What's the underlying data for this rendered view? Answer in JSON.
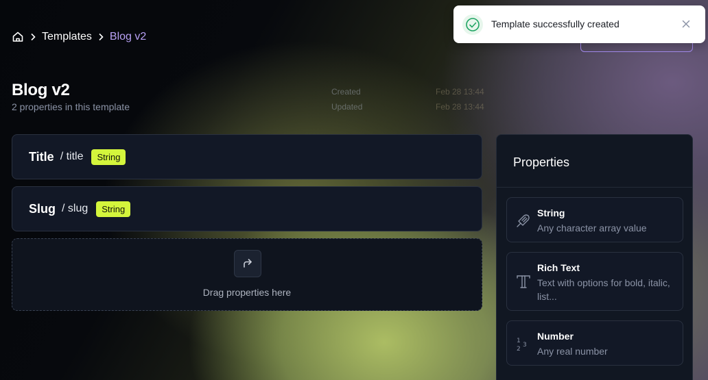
{
  "breadcrumb": {
    "home_icon": "home-icon",
    "separator_icon": "chevron-right-icon",
    "items": [
      "Templates",
      "Blog v2"
    ]
  },
  "header": {
    "title": "Blog v2",
    "subtitle": "2 properties in this template",
    "meta": [
      {
        "label": "Created",
        "value": "Feb 28 13:44"
      },
      {
        "label": "Updated",
        "value": "Feb 28 13:44"
      }
    ]
  },
  "fields": [
    {
      "name": "Title",
      "key": "/ title",
      "type": "String"
    },
    {
      "name": "Slug",
      "key": "/ slug",
      "type": "String"
    }
  ],
  "dropzone": {
    "icon": "arrow-forward-icon",
    "text": "Drag properties here"
  },
  "properties_panel": {
    "title": "Properties",
    "items": [
      {
        "icon": "string-icon",
        "title": "String",
        "description": "Any character array value"
      },
      {
        "icon": "rich-text-icon",
        "title": "Rich Text",
        "description": "Text with options for bold, italic, list..."
      },
      {
        "icon": "number-icon",
        "title": "Number",
        "description": "Any real number"
      }
    ]
  },
  "toast": {
    "icon": "check-circle-icon",
    "message": "Template successfully created",
    "close_icon": "close-icon"
  },
  "colors": {
    "accent": "#b8a1f5",
    "badge": "#d4f53c",
    "card_bg": "#121826",
    "success": "#1fa463"
  }
}
